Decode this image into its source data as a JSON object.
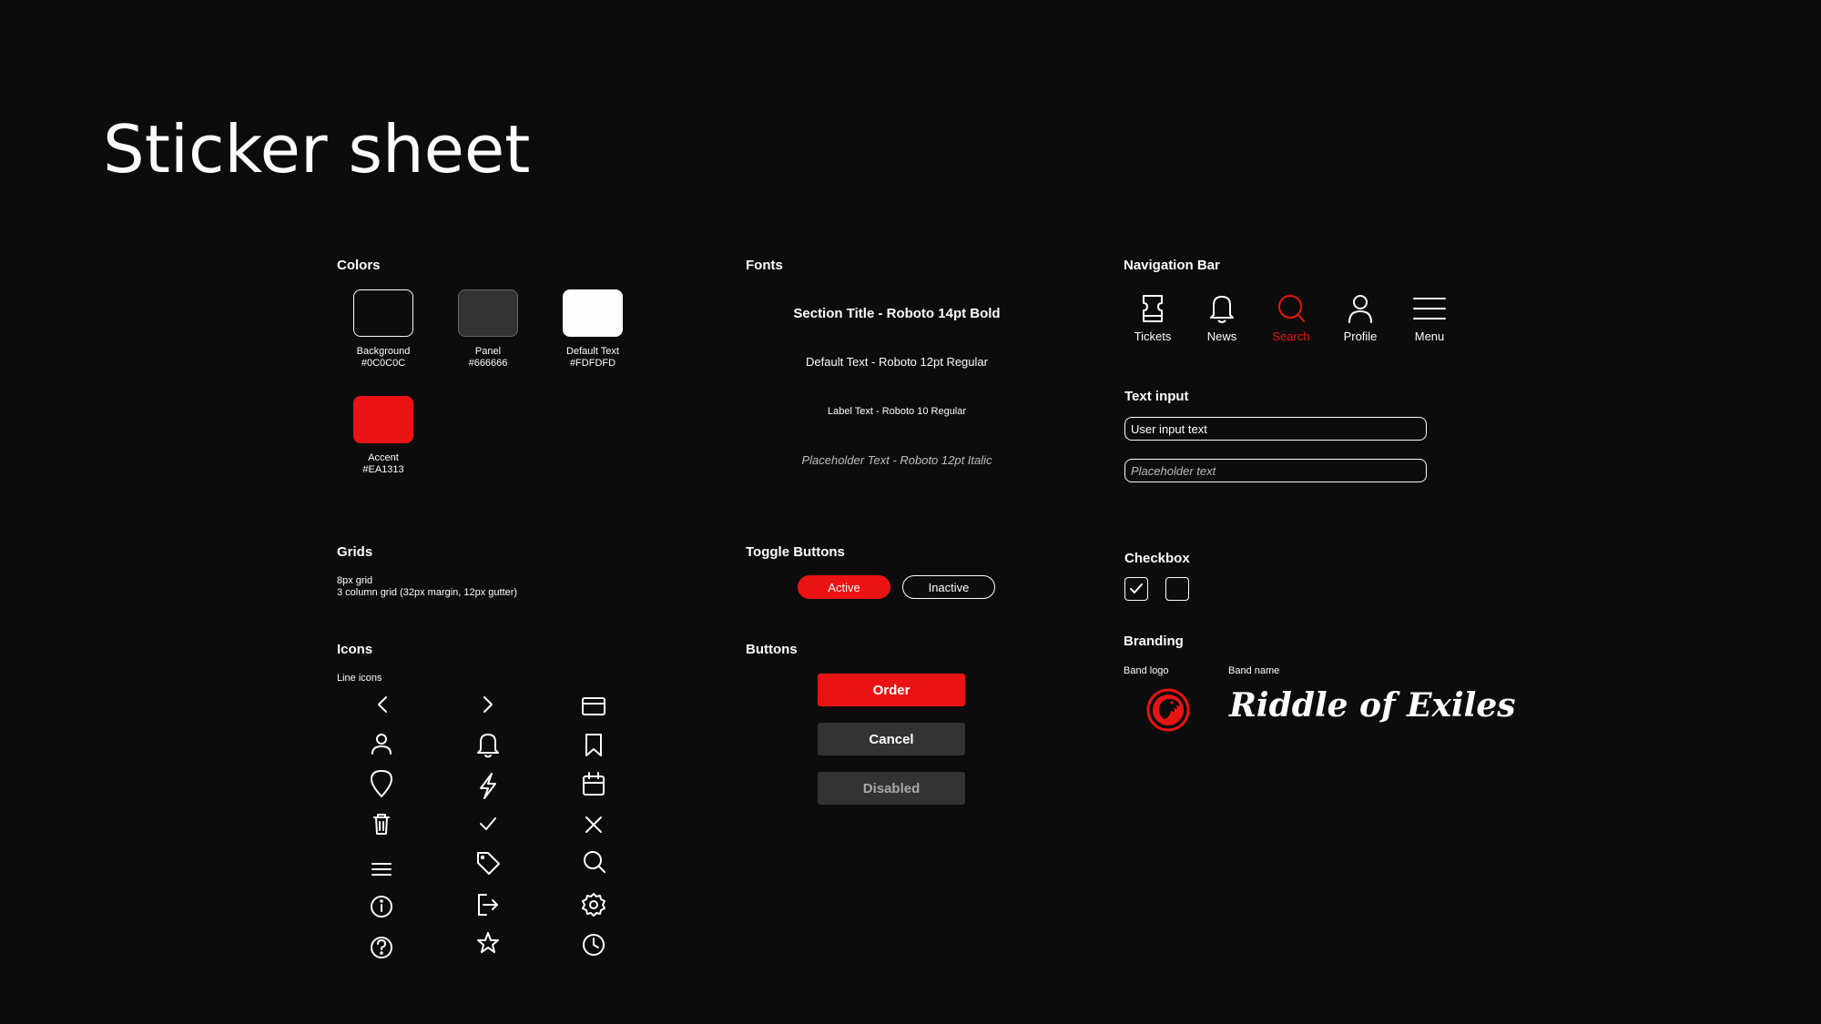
{
  "page_title": "Sticker sheet",
  "colors": {
    "title": "Colors",
    "swatches": [
      {
        "name": "Background",
        "hex": "#0C0C0C"
      },
      {
        "name": "Panel",
        "hex": "#666666"
      },
      {
        "name": "Default Text",
        "hex": "#FDFDFD"
      },
      {
        "name": "Accent",
        "hex": "#EA1313"
      }
    ]
  },
  "grids": {
    "title": "Grids",
    "line1": "8px grid",
    "line2": "3 column grid (32px margin, 12px gutter)"
  },
  "icons": {
    "title": "Icons",
    "subtitle": "Line icons",
    "rows": [
      [
        "chevron-left-icon",
        "chevron-right-icon",
        "credit-card-icon"
      ],
      [
        "user-icon",
        "bell-icon",
        "bookmark-icon"
      ],
      [
        "map-pin-icon",
        "lightning-icon",
        "calendar-icon"
      ],
      [
        "trash-icon",
        "check-icon",
        "close-icon"
      ],
      [
        "menu-icon",
        "tag-icon",
        "search-icon"
      ],
      [
        "info-icon",
        "logout-icon",
        "gear-icon"
      ],
      [
        "help-icon",
        "star-icon",
        "clock-icon"
      ]
    ]
  },
  "fonts": {
    "title": "Fonts",
    "section_title": "Section Title - Roboto 14pt Bold",
    "default_text": "Default Text - Roboto 12pt Regular",
    "label_text": "Label Text - Roboto 10 Regular",
    "placeholder_text": "Placeholder Text - Roboto 12pt Italic"
  },
  "toggle_buttons": {
    "title": "Toggle Buttons",
    "active": "Active",
    "inactive": "Inactive"
  },
  "buttons": {
    "title": "Buttons",
    "order": "Order",
    "cancel": "Cancel",
    "disabled": "Disabled"
  },
  "nav_bar": {
    "title": "Navigation Bar",
    "items": [
      {
        "label": "Tickets",
        "icon": "ticket-icon",
        "active": false
      },
      {
        "label": "News",
        "icon": "bell-icon",
        "active": false
      },
      {
        "label": "Search",
        "icon": "search-icon",
        "active": true
      },
      {
        "label": "Profile",
        "icon": "user-icon",
        "active": false
      },
      {
        "label": "Menu",
        "icon": "menu-icon",
        "active": false
      }
    ]
  },
  "text_input": {
    "title": "Text input",
    "value": "User input text",
    "placeholder": "Placeholder text"
  },
  "checkbox": {
    "title": "Checkbox",
    "checked_state": true,
    "unchecked_state": false
  },
  "branding": {
    "title": "Branding",
    "logo_label": "Band logo",
    "name_label": "Band name",
    "band_name": "Riddle of Exiles"
  }
}
